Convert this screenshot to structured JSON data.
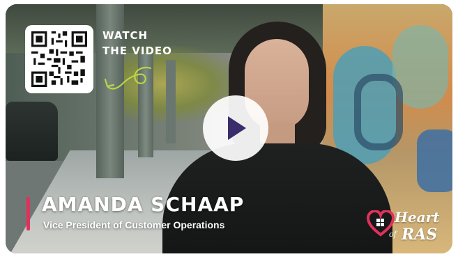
{
  "qr": {
    "cta_line1": "WATCH",
    "cta_line2": "THE VIDEO"
  },
  "video": {
    "play_icon": "play-icon"
  },
  "speaker": {
    "name": "AMANDA SCHAAP",
    "title": "Vice President of Customer Operations"
  },
  "logo": {
    "line1": "Heart",
    "line2_small": "of",
    "line2_big": "RAS",
    "icon": "heart-icon"
  },
  "colors": {
    "accent": "#e0315a",
    "play_triangle": "#3b2c6b",
    "squiggle": "#b7d646"
  }
}
